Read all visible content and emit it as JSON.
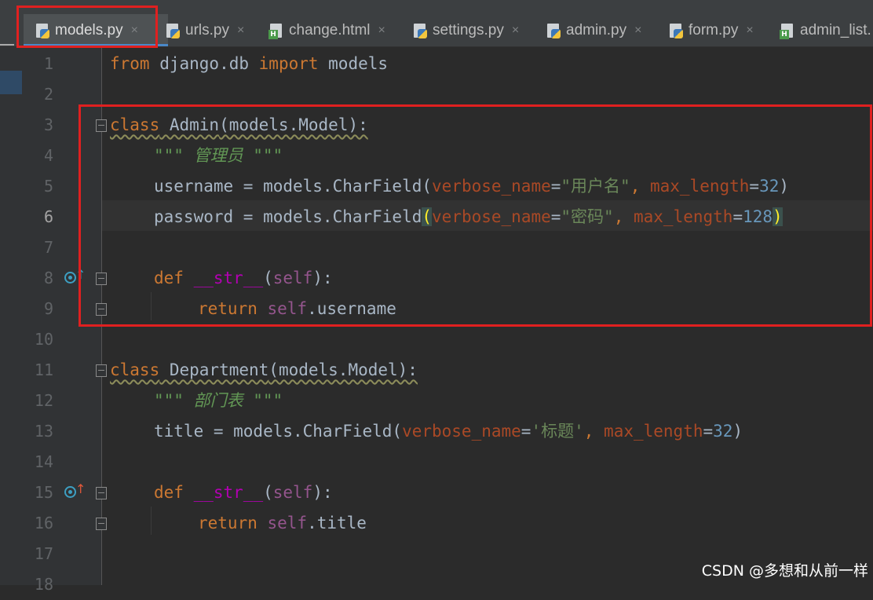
{
  "tabs": [
    {
      "label": "models.py",
      "type": "py",
      "active": true
    },
    {
      "label": "urls.py",
      "type": "py",
      "active": false
    },
    {
      "label": "change.html",
      "type": "html",
      "active": false
    },
    {
      "label": "settings.py",
      "type": "py",
      "active": false
    },
    {
      "label": "admin.py",
      "type": "py",
      "active": false
    },
    {
      "label": "form.py",
      "type": "py",
      "active": false
    },
    {
      "label": "admin_list.",
      "type": "html",
      "active": false
    }
  ],
  "close_glyph": "×",
  "line_numbers": [
    "1",
    "2",
    "3",
    "4",
    "5",
    "6",
    "7",
    "8",
    "9",
    "10",
    "11",
    "12",
    "13",
    "14",
    "15",
    "16",
    "17",
    "18"
  ],
  "current_line": 6,
  "code": {
    "l1": {
      "kw_from": "from",
      "mod": " django.db ",
      "kw_import": "import",
      "rest": " models"
    },
    "l3": {
      "kw": "class",
      "name": " Admin",
      "rest": "(models.Model):"
    },
    "l4": {
      "doc": "\"\"\" 管理员 \"\"\""
    },
    "l5": {
      "a": "username = models.CharField(",
      "p1": "verbose_name",
      "eq1": "=",
      "s1": "\"用户名\"",
      "c": ", ",
      "p2": "max_length",
      "eq2": "=",
      "n": "32",
      "close": ")"
    },
    "l6": {
      "a": "password = models.CharField",
      "open": "(",
      "p1": "verbose_name",
      "eq1": "=",
      "s1": "\"密码\"",
      "c": ", ",
      "p2": "max_length",
      "eq2": "=",
      "n": "128",
      "close": ")"
    },
    "l8": {
      "kw": "def",
      "fn": " __str__",
      "o": "(",
      "self": "self",
      "c": "):"
    },
    "l9": {
      "kw": "return",
      "self": " self",
      "rest": ".username"
    },
    "l11": {
      "kw": "class",
      "name": " Department",
      "rest": "(models.Model):"
    },
    "l12": {
      "doc": "\"\"\" 部门表 \"\"\""
    },
    "l13": {
      "a": "title = models.CharField(",
      "p1": "verbose_name",
      "eq1": "=",
      "s1": "'标题'",
      "c": ", ",
      "p2": "max_length",
      "eq2": "=",
      "n": "32",
      "close": ")"
    },
    "l15": {
      "kw": "def",
      "fn": " __str__",
      "o": "(",
      "self": "self",
      "c": "):"
    },
    "l16": {
      "kw": "return",
      "self": " self",
      "rest": ".title"
    }
  },
  "gutter_icons": [
    {
      "line": 8,
      "icon": "override-icon",
      "arrow": "↑",
      "arrow_color": "#3d9fc2"
    },
    {
      "line": 15,
      "icon": "override-icon",
      "arrow": "↑",
      "arrow_color": "#e0583a"
    }
  ],
  "colors": {
    "highlight_box": "#e02020",
    "keyword": "#cc7832",
    "string": "#6a8759",
    "number": "#6897bb"
  },
  "watermark": "CSDN @多想和从前一样"
}
